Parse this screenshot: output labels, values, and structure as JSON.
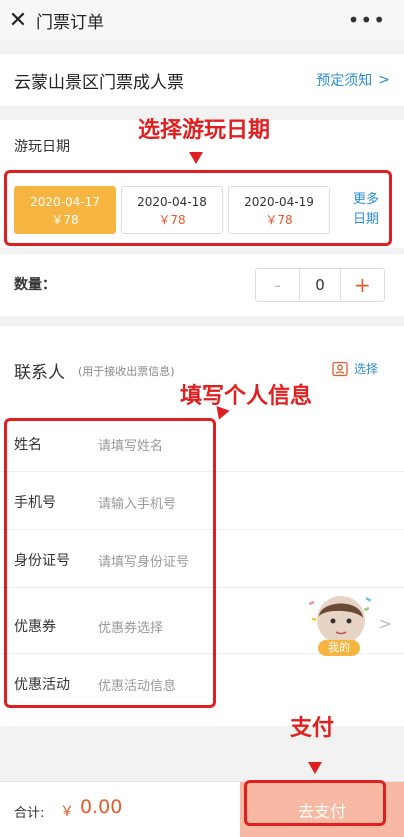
{
  "window": {
    "title": "门票订单",
    "close_icon": "close-icon",
    "more_icon": "more-dots-icon"
  },
  "product": {
    "name": "云蒙山景区门票成人票",
    "notice_label": "预定须知"
  },
  "date_section": {
    "label": "游玩日期",
    "dates": [
      {
        "date": "2020-04-17",
        "price": "￥78",
        "selected": true
      },
      {
        "date": "2020-04-18",
        "price": "￥78",
        "selected": false
      },
      {
        "date": "2020-04-19",
        "price": "￥78",
        "selected": false
      }
    ],
    "more_line1": "更多",
    "more_line2": "日期"
  },
  "quantity": {
    "label": "数量：",
    "minus": "-",
    "value": "0",
    "plus": "+"
  },
  "contact": {
    "title": "联系人",
    "subtitle": "(用于接收出票信息)",
    "choose_label": "选择",
    "fields": [
      {
        "key": "姓名",
        "placeholder": "请填写姓名"
      },
      {
        "key": "手机号",
        "placeholder": "请输入手机号"
      },
      {
        "key": "身份证号",
        "placeholder": "请填写身份证号"
      }
    ],
    "coupon": {
      "key": "优惠券",
      "value": "优惠券选择"
    },
    "activity": {
      "key": "优惠活动",
      "value": "优惠活动信息"
    },
    "avatar_badge": "我的"
  },
  "annotations": {
    "date_note": "选择游玩日期",
    "info_note": "填写个人信息",
    "pay_note": "支付"
  },
  "footer": {
    "total_label": "合计:",
    "currency": "￥",
    "amount": "0.00",
    "pay_label": "去支付"
  },
  "colors": {
    "accent": "#2a8fd6",
    "price": "#e65a2d",
    "selected_date": "#f6b441",
    "annotation": "#e02020",
    "pay_button": "#f7b9a3"
  }
}
